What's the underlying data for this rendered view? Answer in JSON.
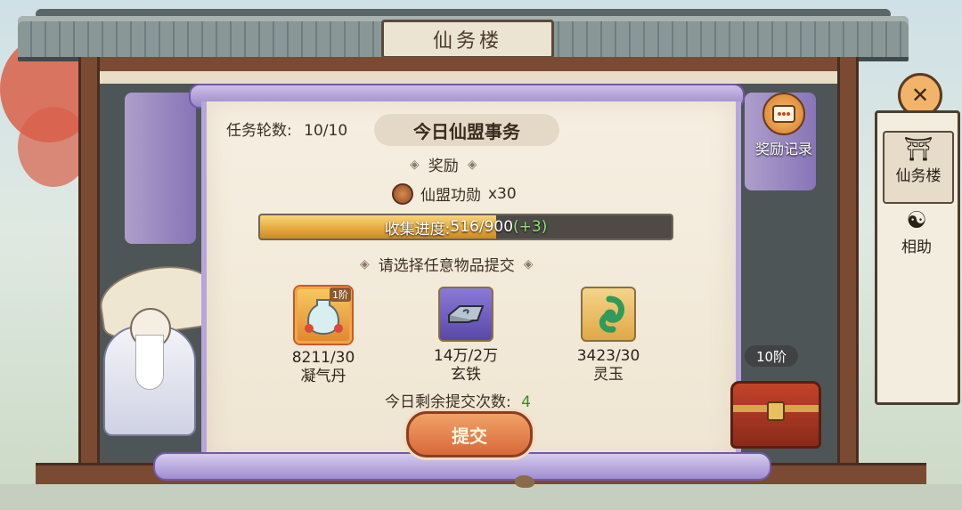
{
  "header": {
    "title": "仙务楼"
  },
  "task": {
    "round_label": "任务轮数:",
    "round_value": "10/10",
    "heading": "今日仙盟事务"
  },
  "reward": {
    "section_label": "奖励",
    "item_name": "仙盟功勋",
    "item_qty": "x30"
  },
  "progress": {
    "label": "收集进度:",
    "current": 516,
    "total": 900,
    "text": "516/900",
    "bonus": "(+3)"
  },
  "submit_section": {
    "label": "请选择任意物品提交"
  },
  "items": [
    {
      "count": "8211/30",
      "name": "凝气丹",
      "tier": "1阶",
      "selected": true,
      "icon": "vase-icon"
    },
    {
      "count": "14万/2万",
      "name": "玄铁",
      "tier": "",
      "selected": false,
      "icon": "iron-ingot-icon"
    },
    {
      "count": "3423/30",
      "name": "灵玉",
      "tier": "",
      "selected": false,
      "icon": "jade-icon"
    }
  ],
  "remaining": {
    "label": "今日剩余提交次数:",
    "value": "4"
  },
  "submit_button": {
    "label": "提交"
  },
  "sidebar": {
    "reward_record": "奖励记录",
    "tabs": [
      {
        "label": "仙务楼",
        "active": true,
        "icon": "pavilion-icon"
      },
      {
        "label": "相助",
        "active": false,
        "icon": "helper-icon"
      }
    ]
  },
  "chest": {
    "tier_label": "10阶"
  },
  "colors": {
    "accent": "#d8683a",
    "progress": "#e5a83c",
    "bonus": "#3a8a2c",
    "scroll_border": "#b8a6da"
  }
}
